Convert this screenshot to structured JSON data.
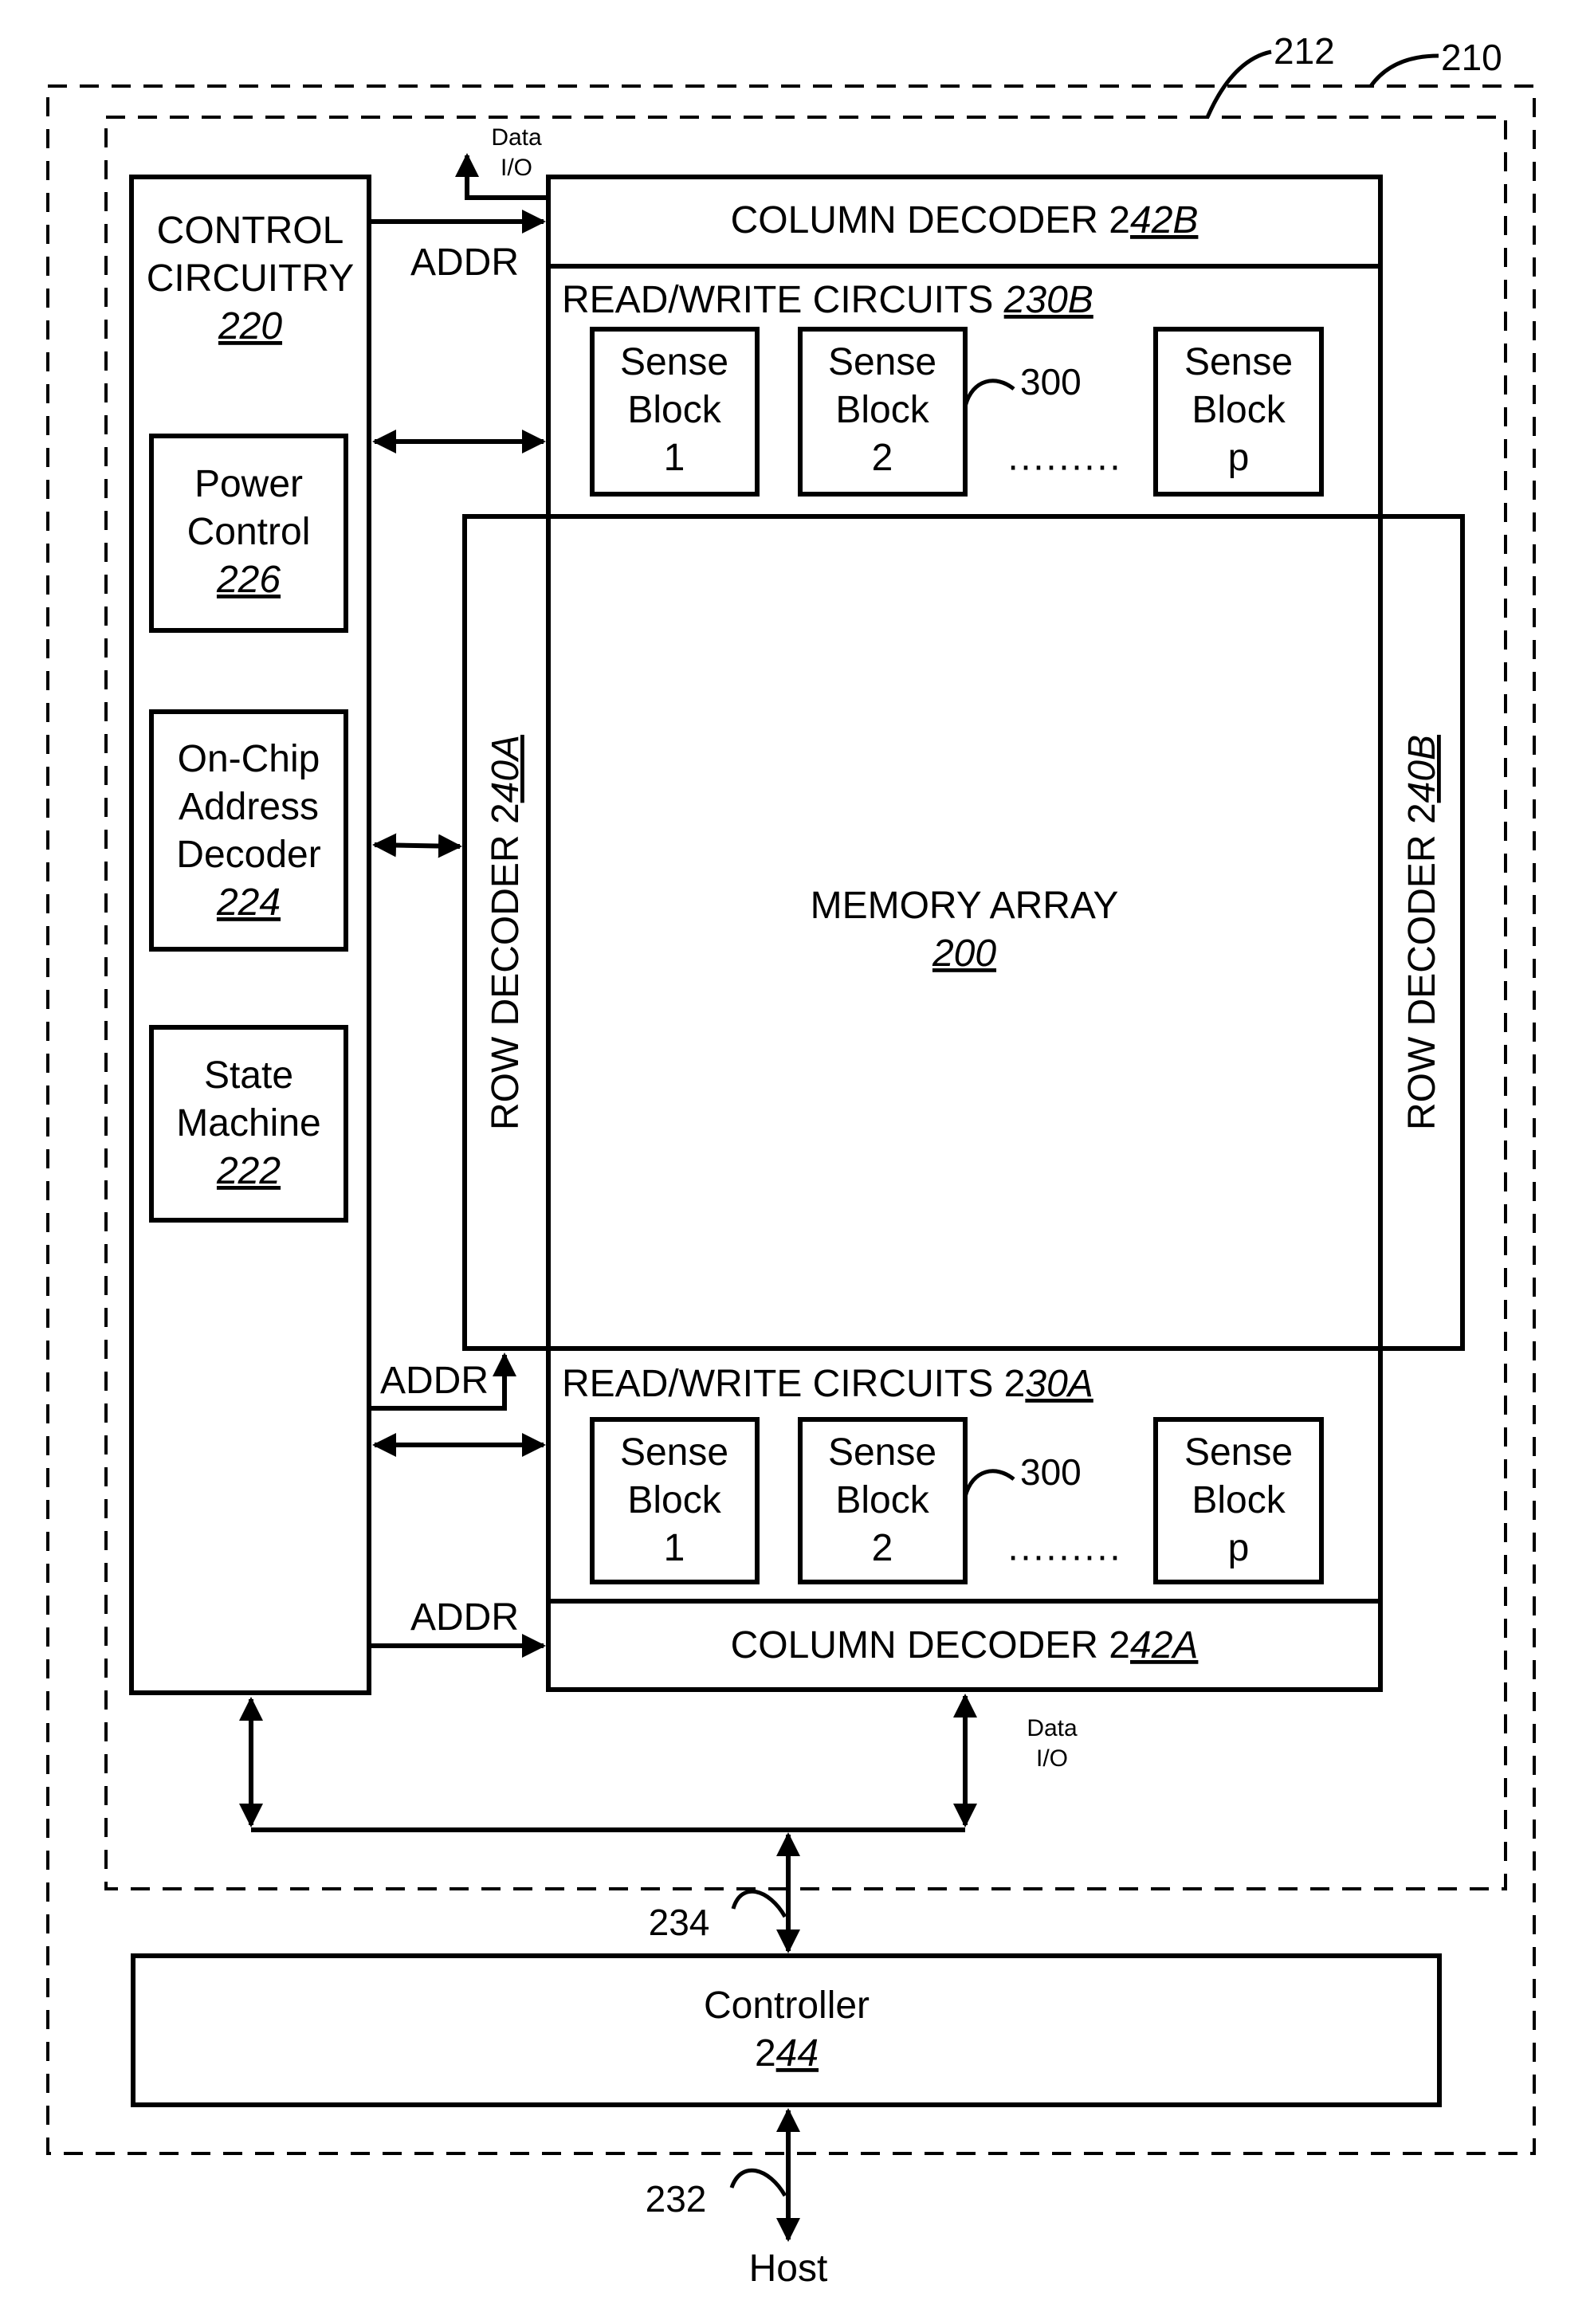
{
  "figure": {
    "outer_boundary_ref": "210",
    "inner_boundary_ref": "212"
  },
  "control": {
    "title_line1": "CONTROL",
    "title_line2": "CIRCUITRY",
    "ref": "220",
    "power": {
      "line1": "Power",
      "line2": "Control",
      "ref": "226"
    },
    "address_decoder": {
      "line1": "On-Chip",
      "line2": "Address",
      "line3": "Decoder",
      "ref": "224"
    },
    "state_machine": {
      "line1": "State",
      "line2": "Machine",
      "ref": "222"
    }
  },
  "column_decoder_top": {
    "label": "COLUMN DECODER 2",
    "ref_underlined": "42B"
  },
  "column_decoder_bottom": {
    "label": "COLUMN DECODER 2",
    "ref_underlined": "42A"
  },
  "rw_top": {
    "label": "READ/WRITE CIRCUITS ",
    "ref_underlined": "230B"
  },
  "rw_bottom": {
    "label": "READ/WRITE CIRCUITS 2",
    "ref_underlined": "30A"
  },
  "sense_blocks": [
    {
      "line1": "Sense",
      "line2": "Block",
      "line3": "1"
    },
    {
      "line1": "Sense",
      "line2": "Block",
      "line3": "2"
    },
    {
      "line1": "Sense",
      "line2": "Block",
      "line3": "p"
    }
  ],
  "sense_ref": "300",
  "ellipsis": "·········",
  "row_decoder_left": {
    "label": "ROW DECODER 2",
    "ref_underlined": "40A"
  },
  "row_decoder_right": {
    "label": "ROW DECODER 2",
    "ref_underlined": "40B"
  },
  "memory_array": {
    "label": "MEMORY ARRAY",
    "ref": "200"
  },
  "signals": {
    "addr": "ADDR",
    "data_line1": "Data",
    "data_line2": "I/O"
  },
  "controller": {
    "label": "Controller",
    "ref_plain": "2",
    "ref_underlined": "44"
  },
  "bus_refs": {
    "internal": "234",
    "host": "232"
  },
  "host": "Host"
}
